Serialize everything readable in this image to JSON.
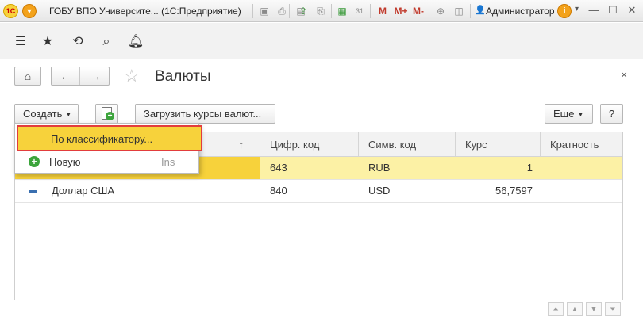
{
  "window": {
    "app_title": "ГОБУ ВПО Университе... (1С:Предприятие)",
    "logo_text": "1С",
    "user_name": "Администратор",
    "info_symbol": "i",
    "toolbar_labels": {
      "m": "M",
      "m_plus": "M+",
      "m_minus": "M-"
    },
    "calendar_day": "31"
  },
  "form": {
    "title": "Валюты",
    "close_symbol": "×"
  },
  "command_bar": {
    "create_label": "Создать",
    "load_rates_label": "Загрузить курсы валют...",
    "more_label": "Еще",
    "help_label": "?"
  },
  "dropdown": {
    "items": [
      {
        "label": "По классификатору...",
        "shortcut": ""
      },
      {
        "label": "Новую",
        "shortcut": "Ins"
      }
    ]
  },
  "table": {
    "columns": [
      "Цифр. код",
      "Симв. код",
      "Курс",
      "Кратность"
    ],
    "sort_indicator": "↑",
    "rows": [
      {
        "name": "",
        "digital_code": "643",
        "symbol_code": "RUB",
        "rate": "1",
        "multiplicity": ""
      },
      {
        "name": "Доллар США",
        "digital_code": "840",
        "symbol_code": "USD",
        "rate": "56,7597",
        "multiplicity": ""
      }
    ]
  },
  "icons": {
    "home": "home-icon",
    "back": "arrow-left-icon",
    "forward": "arrow-right-icon",
    "favorite": "star-icon",
    "history": "history-icon",
    "search": "search-icon",
    "notifications": "bell-icon"
  },
  "colors": {
    "selection_row": "#fcf1a5",
    "selection_cell": "#f7d23b",
    "highlight_border": "#e23d3d",
    "accent_orange": "#f3a21b"
  }
}
